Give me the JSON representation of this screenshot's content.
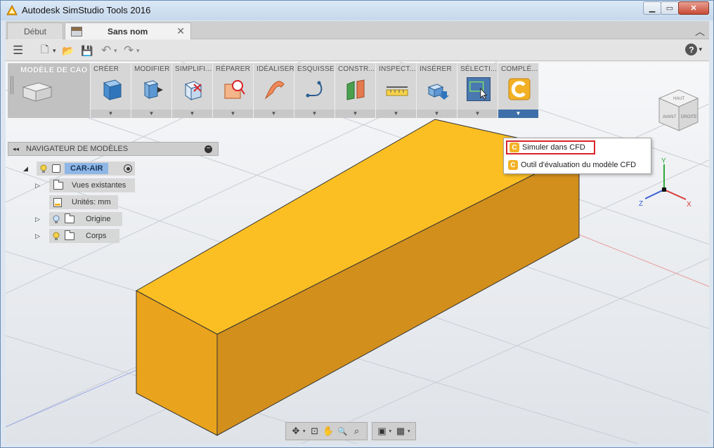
{
  "window": {
    "title": "Autodesk SimStudio Tools 2016",
    "minimize": "▁",
    "maximize": "▭",
    "close": "✕"
  },
  "tabs": {
    "home": "Début",
    "active": "Sans nom",
    "close": "✕",
    "collapse": "︿"
  },
  "qat": {
    "menu": "☰",
    "file": "🗋",
    "open": "📂",
    "save": "💾",
    "undo": "↶",
    "redo": "↷",
    "dropdown": "▾",
    "help": "?"
  },
  "ribbon": {
    "groups": [
      {
        "label": "MODÈLE DE CAO"
      },
      {
        "label": "CRÉER"
      },
      {
        "label": "MODIFIER"
      },
      {
        "label": "SIMPLIFI..."
      },
      {
        "label": "RÉPARER"
      },
      {
        "label": "IDÉALISER"
      },
      {
        "label": "ESQUISSE"
      },
      {
        "label": "CONSTR..."
      },
      {
        "label": "INSPECT..."
      },
      {
        "label": "INSÉRER"
      },
      {
        "label": "SÉLECTI..."
      },
      {
        "label": "COMPLÉ..."
      }
    ],
    "arrow": "▼"
  },
  "dropdown": {
    "items": [
      {
        "label": "Simuler dans CFD"
      },
      {
        "label": "Outil d'évaluation du modèle CFD"
      }
    ],
    "icon_letter": "C"
  },
  "navigator": {
    "title": "NAVIGATEUR DE MODÈLES",
    "arrows": "◂◂",
    "minus": "−",
    "root": "CAR-AIR",
    "children": [
      {
        "label": "Vues existantes"
      },
      {
        "label": "Unités: mm"
      },
      {
        "label": "Origine"
      },
      {
        "label": "Corps"
      }
    ],
    "tri_open": "◢",
    "tri_closed": "▷"
  },
  "viewcube": {
    "top": "HAUT",
    "front": "AVANT",
    "right": "DROITE"
  },
  "axes": {
    "y": "Y",
    "x": "X",
    "z": "Z"
  },
  "colors": {
    "box_top": "#fbbf24",
    "box_front": "#e9a31c",
    "box_side": "#d28f1c",
    "highlight": "#d8232a",
    "selected": "#3e6fa8"
  },
  "bottom_toolbar": {
    "orbit": "✥",
    "look": "⊡",
    "pan": "✋",
    "zoom": "🔍",
    "fit": "⌕",
    "display": "▣",
    "grid": "▦",
    "dropdown": "▾"
  }
}
